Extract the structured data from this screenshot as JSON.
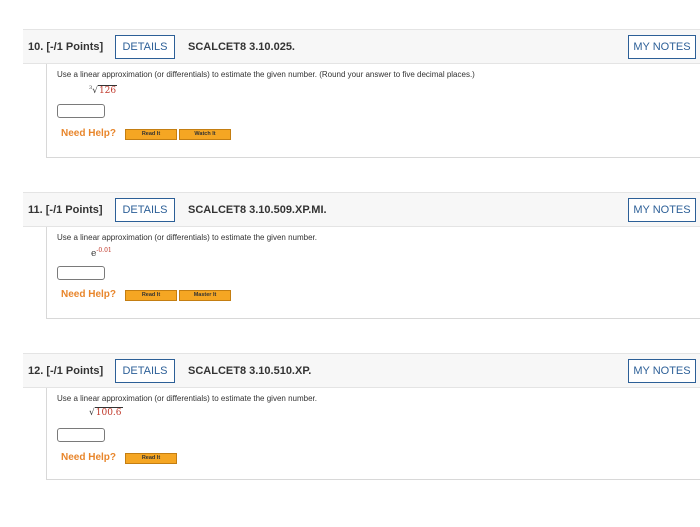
{
  "questions": [
    {
      "number": "10.",
      "points": "[-/1 Points]",
      "details": "DETAILS",
      "code": "SCALCET8 3.10.025.",
      "notes": "MY NOTES",
      "prompt": "Use a linear approximation (or differentials) to estimate the given number. (Round your answer to five decimal places.)",
      "expr_index": "3",
      "expr_value": "126",
      "need_help": "Need Help?",
      "help_buttons": [
        "Read It",
        "Watch It"
      ]
    },
    {
      "number": "11.",
      "points": "[-/1 Points]",
      "details": "DETAILS",
      "code": "SCALCET8 3.10.509.XP.MI.",
      "notes": "MY NOTES",
      "prompt": "Use a linear approximation (or differentials) to estimate the given number.",
      "expr_base": "e",
      "expr_exponent": "-0.01",
      "need_help": "Need Help?",
      "help_buttons": [
        "Read It",
        "Master It"
      ]
    },
    {
      "number": "12.",
      "points": "[-/1 Points]",
      "details": "DETAILS",
      "code": "SCALCET8 3.10.510.XP.",
      "notes": "MY NOTES",
      "prompt": "Use a linear approximation (or differentials) to estimate the given number.",
      "expr_value": "100.6",
      "need_help": "Need Help?",
      "help_buttons": [
        "Read It"
      ]
    }
  ]
}
